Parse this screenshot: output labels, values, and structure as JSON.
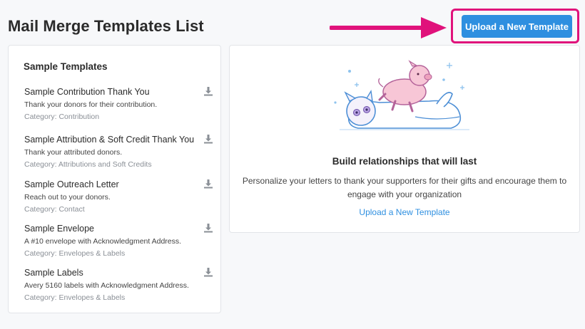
{
  "page": {
    "title": "Mail Merge Templates List"
  },
  "header": {
    "upload_button_label": "Upload a New Template"
  },
  "sample_templates": {
    "heading": "Sample Templates",
    "items": [
      {
        "title": "Sample Contribution Thank You",
        "description": "Thank your donors for their contribution.",
        "category": "Category: Contribution"
      },
      {
        "title": "Sample Attribution & Soft Credit Thank You",
        "description": "Thank your attributed donors.",
        "category": "Category: Attributions and Soft Credits"
      },
      {
        "title": "Sample Outreach Letter",
        "description": "Reach out to your donors.",
        "category": "Category: Contact"
      },
      {
        "title": "Sample Envelope",
        "description": "A #10 envelope with Acknowledgment Address.",
        "category": "Category: Envelopes & Labels"
      },
      {
        "title": "Sample Labels",
        "description": "Avery 5160 labels with Acknowledgment Address.",
        "category": "Category: Envelopes & Labels"
      }
    ]
  },
  "empty_state": {
    "heading": "Build relationships that will last",
    "description": "Personalize your letters to thank your supporters for their gifts and encourage them to engage with your organization",
    "link_label": "Upload a New Template"
  },
  "icons": {
    "download": "download-icon",
    "arrow": "pointer-arrow-icon"
  },
  "colors": {
    "accent": "#2e8fe0",
    "highlight": "#e0127b"
  }
}
